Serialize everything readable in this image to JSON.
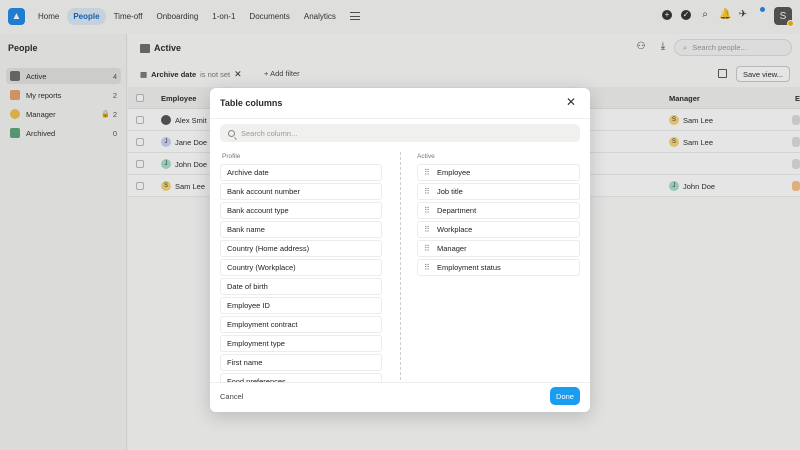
{
  "nav": {
    "logo": "▲",
    "items": [
      {
        "label": "Home",
        "active": false
      },
      {
        "label": "People",
        "active": true
      },
      {
        "label": "Time-off",
        "active": false
      },
      {
        "label": "Onboarding",
        "active": false
      },
      {
        "label": "1-on-1",
        "active": false
      },
      {
        "label": "Documents",
        "active": false
      },
      {
        "label": "Analytics",
        "active": false
      }
    ],
    "user_initial": "S"
  },
  "sidebar": {
    "title": "People",
    "items": [
      {
        "label": "Active",
        "count": "4"
      },
      {
        "label": "My reports",
        "count": "2"
      },
      {
        "label": "Manager",
        "count": "2"
      },
      {
        "label": "Archived",
        "count": "0"
      }
    ]
  },
  "main": {
    "title": "Active",
    "search_placeholder": "Search people...",
    "filter": {
      "field": "Archive date",
      "condition": "is not set"
    },
    "add_filter": "Add filter",
    "save_view": "Save view...",
    "headers": {
      "employee": "Employee",
      "manager": "Manager",
      "extra": "E"
    },
    "rows": [
      {
        "employee": "Alex Smit",
        "emp_initial": "",
        "manager": "Sam Lee",
        "mgr_initial": "S"
      },
      {
        "employee": "Jane Doe",
        "emp_initial": "J",
        "manager": "Sam Lee",
        "mgr_initial": "S"
      },
      {
        "employee": "John Doe",
        "emp_initial": "J",
        "manager": "",
        "mgr_initial": ""
      },
      {
        "employee": "Sam Lee",
        "emp_initial": "S",
        "manager": "John Doe",
        "mgr_initial": "J"
      }
    ]
  },
  "modal": {
    "title": "Table columns",
    "search_placeholder": "Search column...",
    "profile_label": "Profile",
    "active_label": "Active",
    "profile_columns": [
      "Archive date",
      "Bank account number",
      "Bank account type",
      "Bank name",
      "Country (Home address)",
      "Country (Workplace)",
      "Date of birth",
      "Employee ID",
      "Employment contract",
      "Employment type",
      "First name",
      "Food preferences"
    ],
    "active_columns": [
      "Employee",
      "Job title",
      "Department",
      "Workplace",
      "Manager",
      "Employment status"
    ],
    "cancel": "Cancel",
    "done": "Done"
  },
  "colors": {
    "accent": "#1a9cf0",
    "nav_active_bg": "#dbe9f6"
  }
}
